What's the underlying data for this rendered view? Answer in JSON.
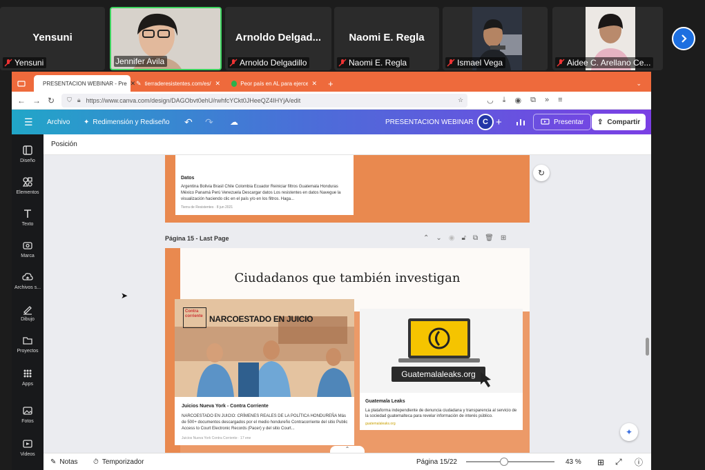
{
  "participants": [
    {
      "name": "Yensuni",
      "display": "Yensuni",
      "muted": true,
      "has_video": false
    },
    {
      "name": "Jennifer Avila",
      "muted": false,
      "has_video": true,
      "active_speaker": true
    },
    {
      "name": "Arnoldo Delgadillo",
      "display": "Arnoldo  Delgad...",
      "muted": true,
      "has_video": false
    },
    {
      "name": "Naomi E. Regla",
      "display": "Naomi E. Regla",
      "muted": true,
      "has_video": false
    },
    {
      "name": "Ismael Vega",
      "muted": true,
      "has_video": true
    },
    {
      "name": "Aidee C. Arellano Ce...",
      "muted": true,
      "has_video": true
    }
  ],
  "browser": {
    "tabs": [
      {
        "label": "PRESENTACION WEBINAR - Pre",
        "active": true
      },
      {
        "label": "tierraderesistentes.com/es/datos",
        "active": false
      },
      {
        "label": "Peor país en AL para ejercer pe",
        "active": false
      }
    ],
    "url": "https://www.canva.com/design/DAGObvt0ehU/rwhfcYCkt0JHeeQZ4IHYjA/edit"
  },
  "canva": {
    "menu": {
      "file": "Archivo",
      "resize": "Redimensión y Rediseño"
    },
    "doc_title": "PRESENTACION WEBINAR",
    "avatar_letter": "C",
    "present_label": "Presentar",
    "share_label": "Compartir",
    "position_label": "Posición",
    "sidebar": [
      {
        "label": "Diseño",
        "icon": "layout-icon"
      },
      {
        "label": "Elementos",
        "icon": "elements-icon"
      },
      {
        "label": "Texto",
        "icon": "text-icon"
      },
      {
        "label": "Marca",
        "icon": "brand-icon"
      },
      {
        "label": "Archivos s...",
        "icon": "cloud-upload-icon"
      },
      {
        "label": "Dibujo",
        "icon": "draw-icon"
      },
      {
        "label": "Proyectos",
        "icon": "folder-icon"
      },
      {
        "label": "Apps",
        "icon": "apps-grid-icon"
      },
      {
        "label": "Fotos",
        "icon": "photo-icon"
      },
      {
        "label": "Videos",
        "icon": "video-icon"
      }
    ],
    "page14_card": {
      "title": "Datos",
      "desc": "Argentina Bolivia Brasil Chile Colombia Ecuador Reiniciar filtros Guatemala Honduras México Panamá Perú Venezuela Descargar datos Los resistentes en datos Navegue la visualización haciendo clic en el país y/o en los filtros. Haga...",
      "source": "Tierra de Resistentes · 8 jun 2021"
    },
    "page15": {
      "label": "Página 15 - Last Page",
      "title": "Ciudadanos que también investigan",
      "card_a": {
        "headline": "NARCOESTADO EN JUICIO",
        "logo_text": "Contra corriente",
        "title": "Juicios Nueva York - Contra Corriente",
        "desc": "NARCOESTADO EN JUICIO: CRÍMENES REALES DE LA POLÍTICA HONDUREÑA Más de 500+ documentos descargados por el medio hondureño Contracorriente del sitio Public Access to Court Electronic Records (Pacer) y del sitio Court...",
        "source": "Juicios Nueva York Contra Corriente · 17 ene"
      },
      "card_b": {
        "image_text": "Guatemalaleaks.org",
        "title": "Guatemala Leaks",
        "desc": "La plataforma independiente de denuncia ciudadana y transparencia al servicio de la sociedad guatemalteca para revelar información de interés público.",
        "source": "guatemalaleaks.org"
      }
    },
    "bottom": {
      "notes": "Notas",
      "timer": "Temporizador",
      "page_indicator": "Página 15/22",
      "zoom": "43 %",
      "zoom_fraction": 0.43
    }
  },
  "colors": {
    "accent_orange": "#ee6a3c",
    "active_speaker": "#3dd45f",
    "canva_purple": "#7b3fe4"
  }
}
